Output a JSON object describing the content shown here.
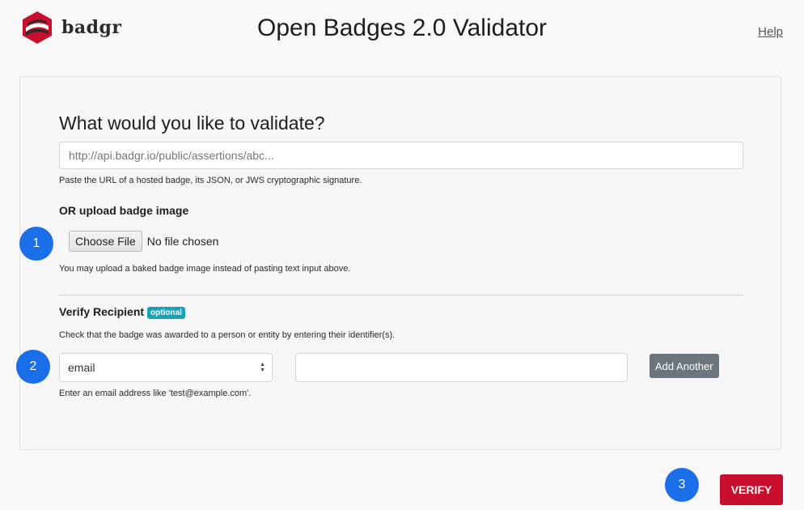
{
  "header": {
    "logo_text": "badgr",
    "title": "Open Badges 2.0 Validator",
    "help_label": "Help"
  },
  "form": {
    "question": "What would you like to validate?",
    "url_placeholder": "http://api.badgr.io/public/assertions/abc...",
    "url_value": "",
    "url_help": "Paste the URL of a hosted badge, its JSON, or JWS cryptographic signature.",
    "upload_heading": "OR upload badge image",
    "choose_file_label": "Choose File",
    "file_status": "No file chosen",
    "upload_help": "You may upload a baked badge image instead of pasting text input above.",
    "recipient_heading": "Verify Recipient",
    "optional_badge": "optional",
    "recipient_help": "Check that the badge was awarded to a person or entity by entering their identifier(s).",
    "recipient_type_selected": "email",
    "identifier_value": "",
    "add_another_label": "Add Another",
    "email_help": "Enter an email address like 'test@example.com'."
  },
  "steps": [
    "1",
    "2",
    "3"
  ],
  "actions": {
    "verify_label": "VERIFY"
  },
  "colors": {
    "brand": "#c8102e",
    "step_marker": "#1a6ee8",
    "optional_badge": "#17a2b8",
    "secondary_button": "#6c757d"
  },
  "icons": {
    "logo": "badgr-shield-icon",
    "select": "select-arrows-icon"
  }
}
